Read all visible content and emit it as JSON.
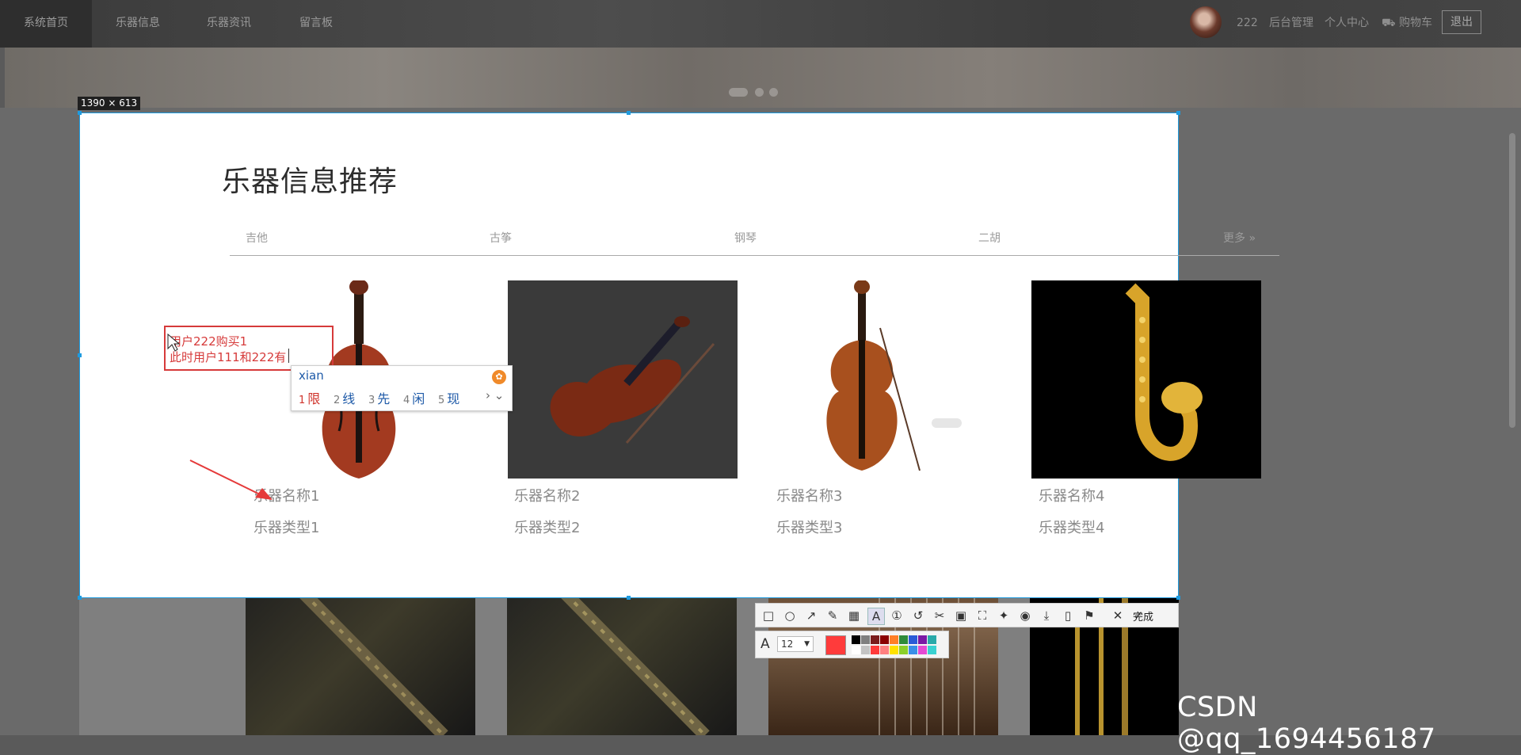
{
  "nav": {
    "items": [
      "系统首页",
      "乐器信息",
      "乐器资讯",
      "留言板"
    ],
    "username": "222",
    "admin": "后台管理",
    "profile": "个人中心",
    "cart": "⛟ 购物车",
    "logout": "退出"
  },
  "capture": {
    "size_label": "1390 × 613"
  },
  "section": {
    "title": "乐器信息推荐",
    "tabs": [
      "吉他",
      "古筝",
      "钢琴",
      "二胡"
    ],
    "more": "更多 »"
  },
  "products": [
    {
      "name": "乐器名称1",
      "type": "乐器类型1"
    },
    {
      "name": "乐器名称2",
      "type": "乐器类型2"
    },
    {
      "name": "乐器名称3",
      "type": "乐器类型3"
    },
    {
      "name": "乐器名称4",
      "type": "乐器类型4"
    }
  ],
  "annotation": {
    "line1": "用户222购买1",
    "line2": "此时用户111和222有"
  },
  "ime": {
    "pinyin": "xian",
    "candidates": [
      {
        "num": "1",
        "text": "限"
      },
      {
        "num": "2",
        "text": "线"
      },
      {
        "num": "3",
        "text": "先"
      },
      {
        "num": "4",
        "text": "闲"
      },
      {
        "num": "5",
        "text": "现"
      }
    ],
    "next": "› ⌄"
  },
  "toolbar": {
    "done": "完成",
    "font_size": "12",
    "text_tool": "A",
    "active_color": "#ff3b3b",
    "palette": [
      "#000000",
      "#7f7f7f",
      "#7a1c1c",
      "#8b0000",
      "#ff7f27",
      "#2e8b3a",
      "#2a5bd7",
      "#7a1aa5",
      "#2aa9a9",
      "#ffffff",
      "#c3c3c3",
      "#ff3b3b",
      "#ff8080",
      "#ffe100",
      "#8bcf2a",
      "#3a8fe8",
      "#e44ad3",
      "#3ad1d1"
    ]
  },
  "watermark": "CSDN @qq_1694456187"
}
